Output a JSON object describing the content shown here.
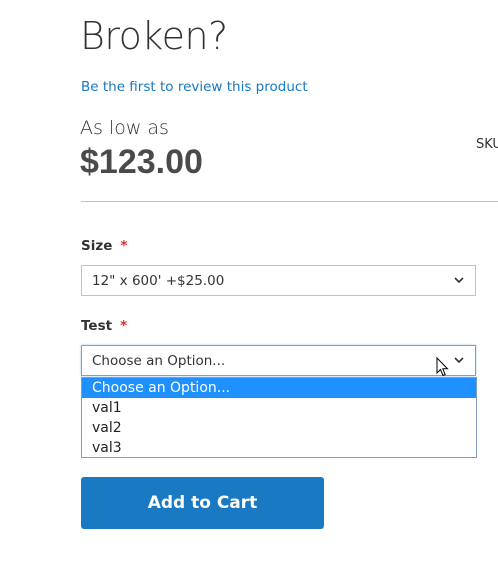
{
  "product": {
    "title": "Broken?",
    "review_link": "Be the first to review this product",
    "as_low_as": "As low as",
    "price": "$123.00",
    "sku_label": "SKU"
  },
  "options": {
    "size": {
      "label": "Size",
      "required_mark": "*",
      "selected": "12\" x 600' +$25.00"
    },
    "test": {
      "label": "Test",
      "required_mark": "*",
      "selected": "Choose an Option...",
      "dropdown_items": [
        "Choose an Option...",
        "val1",
        "val2",
        "val3"
      ]
    }
  },
  "actions": {
    "add_to_cart": "Add to Cart"
  },
  "colors": {
    "link": "#1979c3",
    "button": "#1979c3",
    "required": "#e02b27",
    "highlight": "#1e90ff"
  },
  "icons": {
    "select_arrow": "chevron-down-icon",
    "pointer": "mouse-cursor-icon"
  }
}
